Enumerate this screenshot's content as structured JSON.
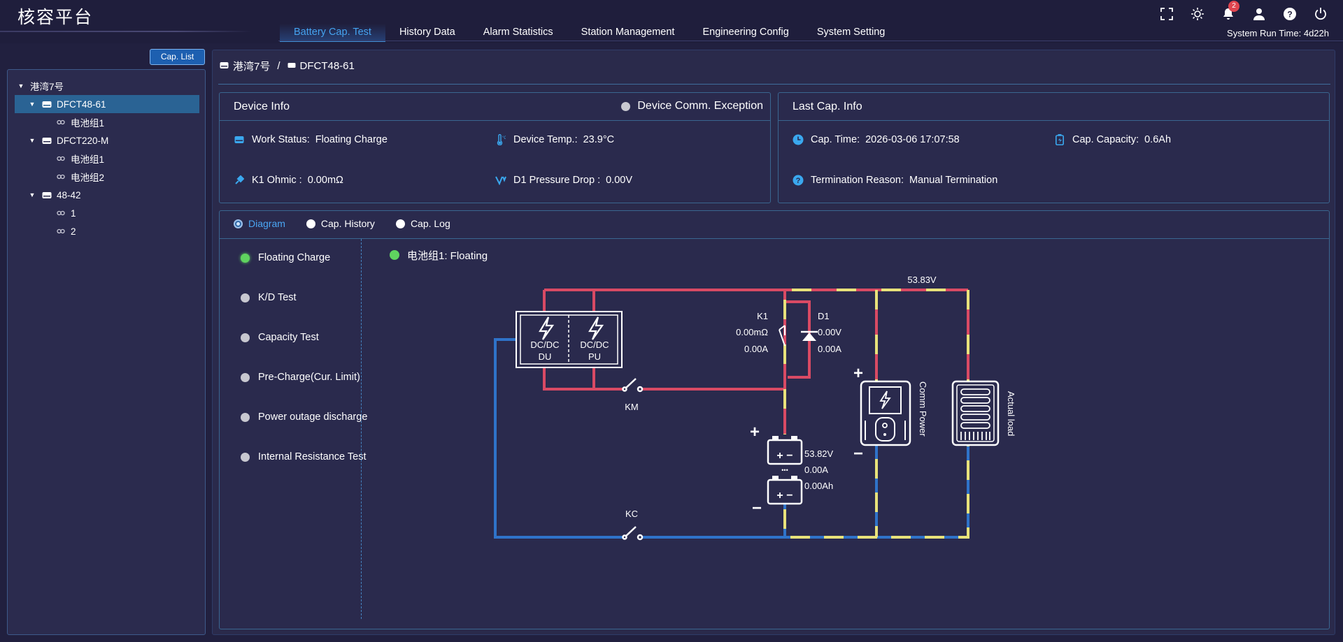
{
  "app": {
    "title": "核容平台",
    "runtime": "System Run Time: 4d22h",
    "notification_count": "2"
  },
  "nav": {
    "tabs": [
      "Battery Cap. Test",
      "History Data",
      "Alarm Statistics",
      "Station Management",
      "Engineering Config",
      "System Setting"
    ],
    "active": 0
  },
  "header_icons": [
    "fullscreen-icon",
    "theme-sun-icon",
    "bell-icon",
    "user-icon",
    "help-icon",
    "power-icon"
  ],
  "left": {
    "cap_list_label": "Cap. List",
    "tree": [
      {
        "label": "港湾7号",
        "level": 0,
        "expanded": true
      },
      {
        "label": "DFCT48-61",
        "level": 1,
        "expanded": true,
        "selected": true
      },
      {
        "label": "电池组1",
        "level": 2
      },
      {
        "label": "DFCT220-M",
        "level": 1,
        "expanded": true
      },
      {
        "label": "电池组1",
        "level": 2
      },
      {
        "label": "电池组2",
        "level": 2
      },
      {
        "label": "48-42",
        "level": 1,
        "expanded": true
      },
      {
        "label": "1",
        "level": 2
      },
      {
        "label": "2",
        "level": 2
      }
    ]
  },
  "breadcrumb": {
    "station": "港湾7号",
    "separator": "/",
    "device": "DFCT48-61"
  },
  "device_info": {
    "title": "Device Info",
    "comm_status": "Device Comm. Exception",
    "work_status_label": "Work Status:",
    "work_status": "Floating Charge",
    "device_temp_label": "Device Temp.:",
    "device_temp": "23.9°C",
    "k1_ohmic_label": "K1 Ohmic :",
    "k1_ohmic": "0.00mΩ",
    "d1_drop_label": "D1 Pressure Drop :",
    "d1_drop": "0.00V"
  },
  "last_cap": {
    "title": "Last Cap. Info",
    "cap_time_label": "Cap. Time:",
    "cap_time": "2026-03-06 17:07:58",
    "cap_capacity_label": "Cap. Capacity:",
    "cap_capacity": "0.6Ah",
    "termination_label": "Termination Reason:",
    "termination": "Manual Termination"
  },
  "diagram_tabs": {
    "items": [
      "Diagram",
      "Cap. History",
      "Cap. Log"
    ],
    "active": 0
  },
  "modes": [
    {
      "label": "Floating Charge",
      "active": true
    },
    {
      "label": "K/D Test",
      "active": false
    },
    {
      "label": "Capacity Test",
      "active": false
    },
    {
      "label": "Pre-Charge(Cur. Limit)",
      "active": false
    },
    {
      "label": "Power outage discharge",
      "active": false
    },
    {
      "label": "Internal Resistance Test",
      "active": false
    }
  ],
  "diagram": {
    "group_status": "电池组1: Floating",
    "bus_voltage": "53.83V",
    "dcdc_left_line1": "DC/DC",
    "dcdc_left_line2": "DU",
    "dcdc_right_line1": "DC/DC",
    "dcdc_right_line2": "PU",
    "km_label": "KM",
    "kc_label": "KC",
    "k1_label": "K1",
    "k1_ohmic": "0.00mΩ",
    "k1_current": "0.00A",
    "d1_label": "D1",
    "d1_voltage": "0.00V",
    "d1_current": "0.00A",
    "battery_voltage": "53.82V",
    "battery_current": "0.00A",
    "battery_capacity": "0.00Ah",
    "comm_power_label": "Comm Power",
    "actual_load_label": "Actual load",
    "plus": "+",
    "minus": "−",
    "bat_plus_minus": "+ −",
    "ellipsis": "•••",
    "colors": {
      "positive": "#d94a64",
      "negative": "#2f73c9",
      "yellow": "#e8e27a",
      "bg": "#2a2a4d"
    }
  }
}
